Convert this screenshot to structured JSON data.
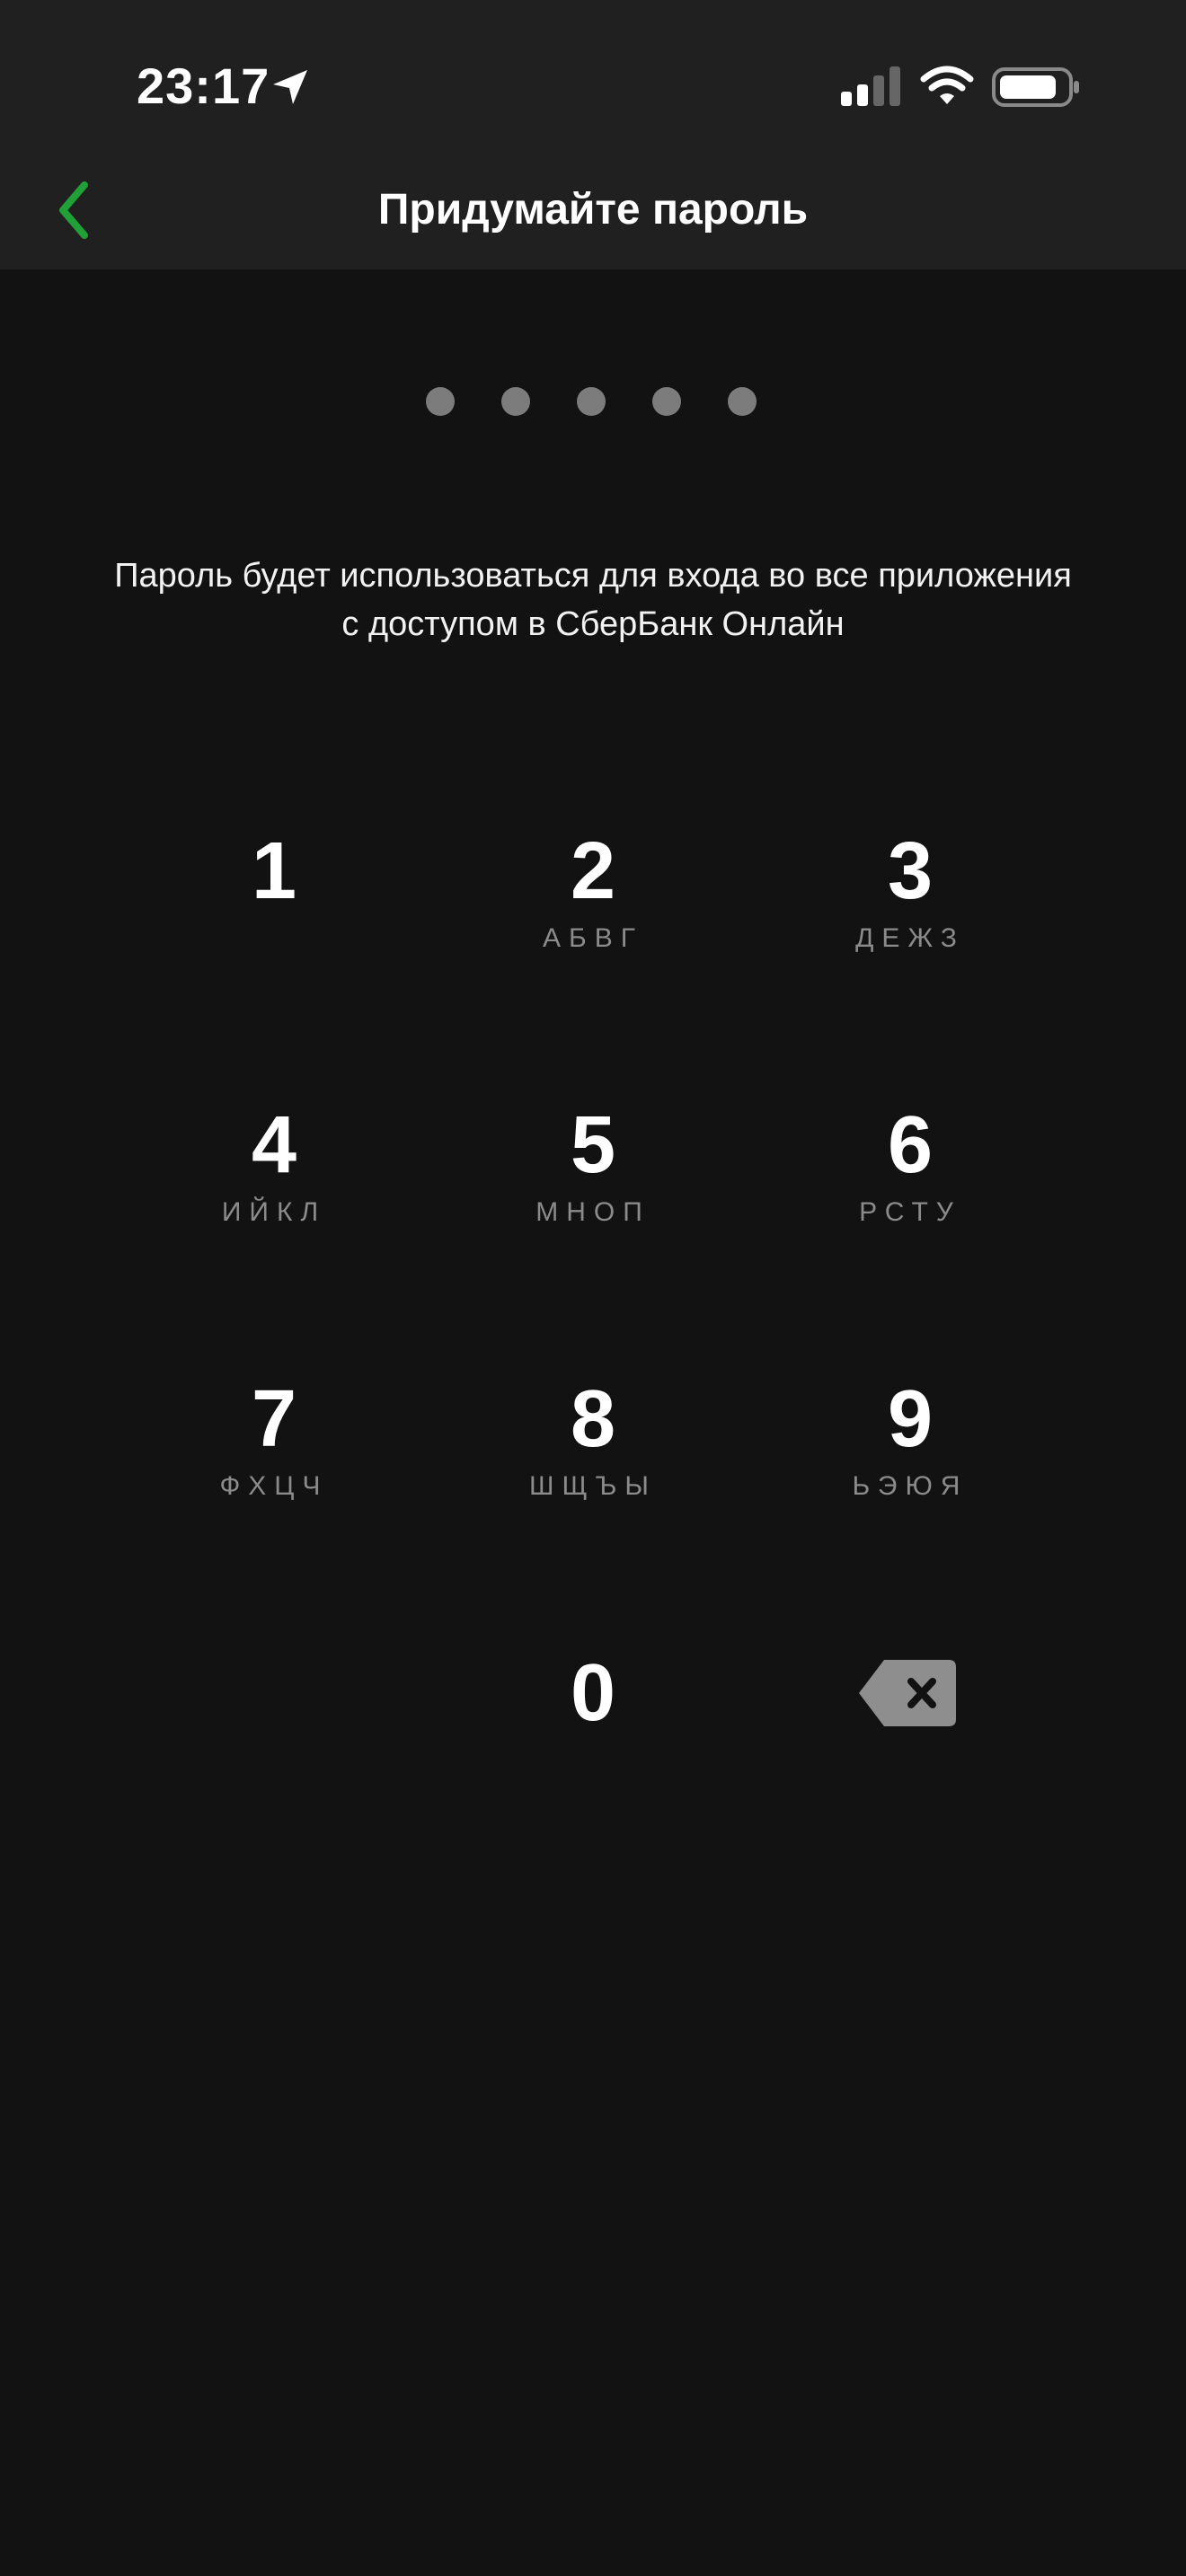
{
  "status_bar": {
    "time": "23:17",
    "icons": [
      "location-arrow-icon",
      "cellular-signal-icon",
      "wifi-icon",
      "battery-icon"
    ]
  },
  "header": {
    "title": "Придумайте пароль",
    "back_icon": "chevron-left-icon"
  },
  "pin": {
    "dots_count": 5,
    "dots_filled": 0
  },
  "hint": {
    "line1": "Пароль будет использоваться для входа во все приложения",
    "line2": "с доступом в СберБанк Онлайн"
  },
  "keypad": {
    "keys": [
      {
        "digit": "1",
        "letters": ""
      },
      {
        "digit": "2",
        "letters": "АБВГ"
      },
      {
        "digit": "3",
        "letters": "ДЕЖЗ"
      },
      {
        "digit": "4",
        "letters": "ИЙКЛ"
      },
      {
        "digit": "5",
        "letters": "МНОП"
      },
      {
        "digit": "6",
        "letters": "РСТУ"
      },
      {
        "digit": "7",
        "letters": "ФХЦЧ"
      },
      {
        "digit": "8",
        "letters": "ШЩЪЫ"
      },
      {
        "digit": "9",
        "letters": "ЬЭЮЯ"
      },
      {
        "digit": "0",
        "letters": ""
      }
    ],
    "backspace_icon": "backspace-icon"
  },
  "colors": {
    "background": "#121212",
    "header_background": "#202020",
    "accent_green": "#21a038",
    "dot_gray": "#7c7c7c",
    "letters_gray": "#8b8b8b"
  }
}
